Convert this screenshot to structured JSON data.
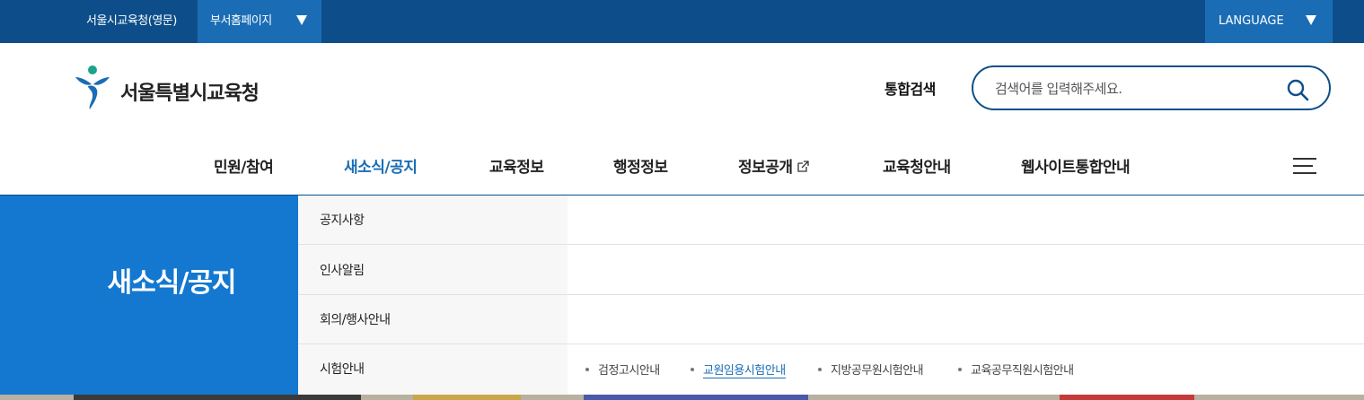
{
  "topbar": {
    "english_link": "서울시교육청(영문)",
    "dept_dropdown": "부서홈페이지",
    "language_dropdown": "LANGUAGE"
  },
  "header": {
    "logo_text": "서울특별시교육청",
    "search_label": "통합검색",
    "search_placeholder": "검색어를 입력해주세요."
  },
  "nav": {
    "items": [
      {
        "label": "민원/참여"
      },
      {
        "label": "새소식/공지",
        "active": true
      },
      {
        "label": "교육정보"
      },
      {
        "label": "행정정보"
      },
      {
        "label": "정보공개",
        "external": true
      },
      {
        "label": "교육청안내"
      },
      {
        "label": "웹사이트통합안내"
      }
    ]
  },
  "submenu": {
    "title": "새소식/공지",
    "items": [
      {
        "label": "공지사항"
      },
      {
        "label": "인사알림"
      },
      {
        "label": "회의/행사안내"
      },
      {
        "label": "시험안내",
        "children": [
          {
            "label": "검정고시안내"
          },
          {
            "label": "교원임용시험안내",
            "active": true
          },
          {
            "label": "지방공무원시험안내"
          },
          {
            "label": "교육공무직원시험안내"
          }
        ]
      }
    ]
  },
  "colors": {
    "topbar": "#0d4e8a",
    "accent": "#1a6db5",
    "submenu_title_bg": "#1478d0"
  }
}
